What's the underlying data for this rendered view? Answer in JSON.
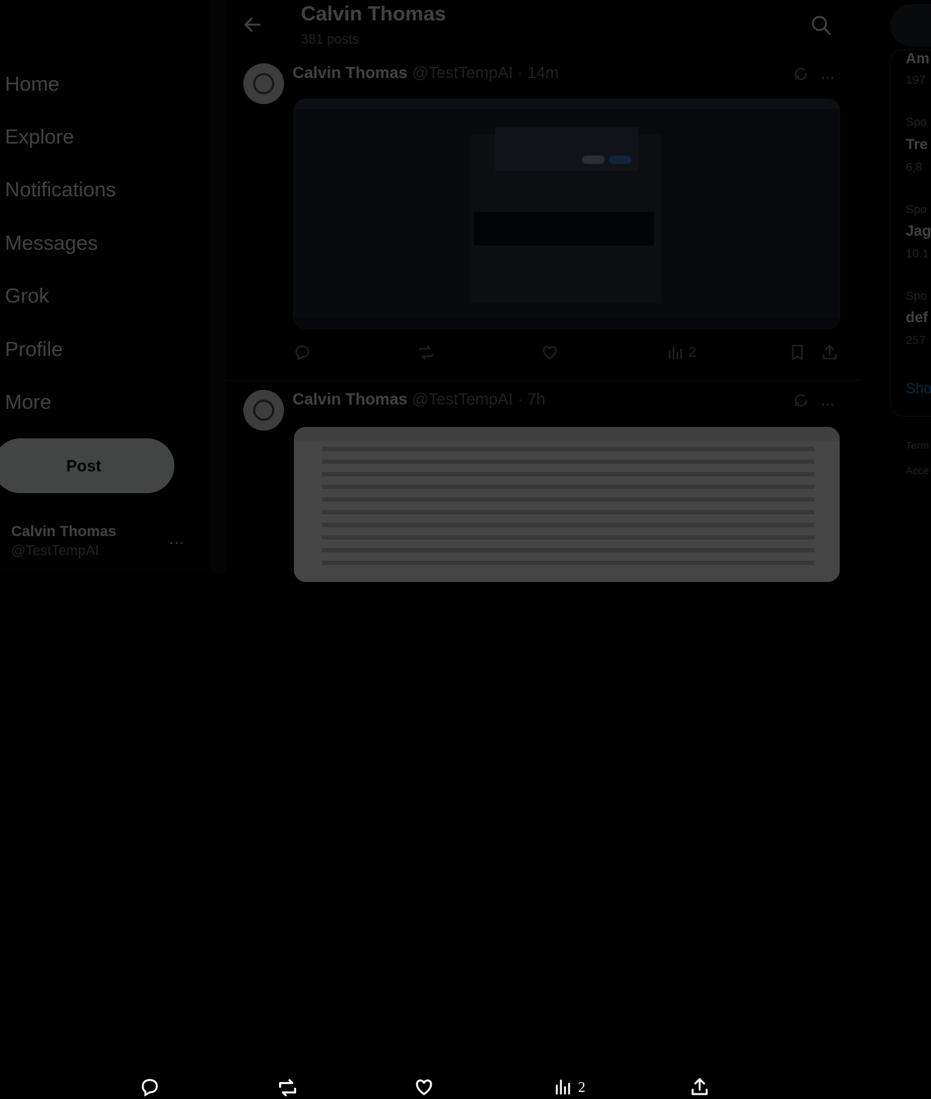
{
  "nav": {
    "items": [
      {
        "label": "Home"
      },
      {
        "label": "Explore"
      },
      {
        "label": "Notifications"
      },
      {
        "label": "Messages"
      },
      {
        "label": "Grok"
      },
      {
        "label": "Profile"
      },
      {
        "label": "More"
      }
    ],
    "post_label": "Post",
    "account": {
      "name": "Calvin Thomas",
      "handle": "@TestTempAI",
      "more": "···"
    }
  },
  "header": {
    "title": "Calvin Thomas",
    "subtitle": "381 posts"
  },
  "tweets": [
    {
      "name": "Calvin Thomas",
      "handle": "@TestTempAI",
      "time": "· 14m",
      "views": "2"
    },
    {
      "name": "Calvin Thomas",
      "handle": "@TestTempAI",
      "time": "· 7h"
    }
  ],
  "right": {
    "trends": [
      {
        "title": "Am",
        "count": "197"
      },
      {
        "category": "Spo",
        "title": "Tre",
        "count": "6,8"
      },
      {
        "category": "Spo",
        "title": "Jag",
        "count": "10.1"
      },
      {
        "category": "Spo",
        "title": "def",
        "count": "257"
      }
    ],
    "show_more": "Sho",
    "footer": [
      "Term",
      "Acce"
    ]
  },
  "overlay": {
    "views": "2"
  },
  "colors": {
    "accent": "#1d9bf0",
    "background": "#000000",
    "text": "#e7e9ea",
    "muted": "#71767b"
  }
}
